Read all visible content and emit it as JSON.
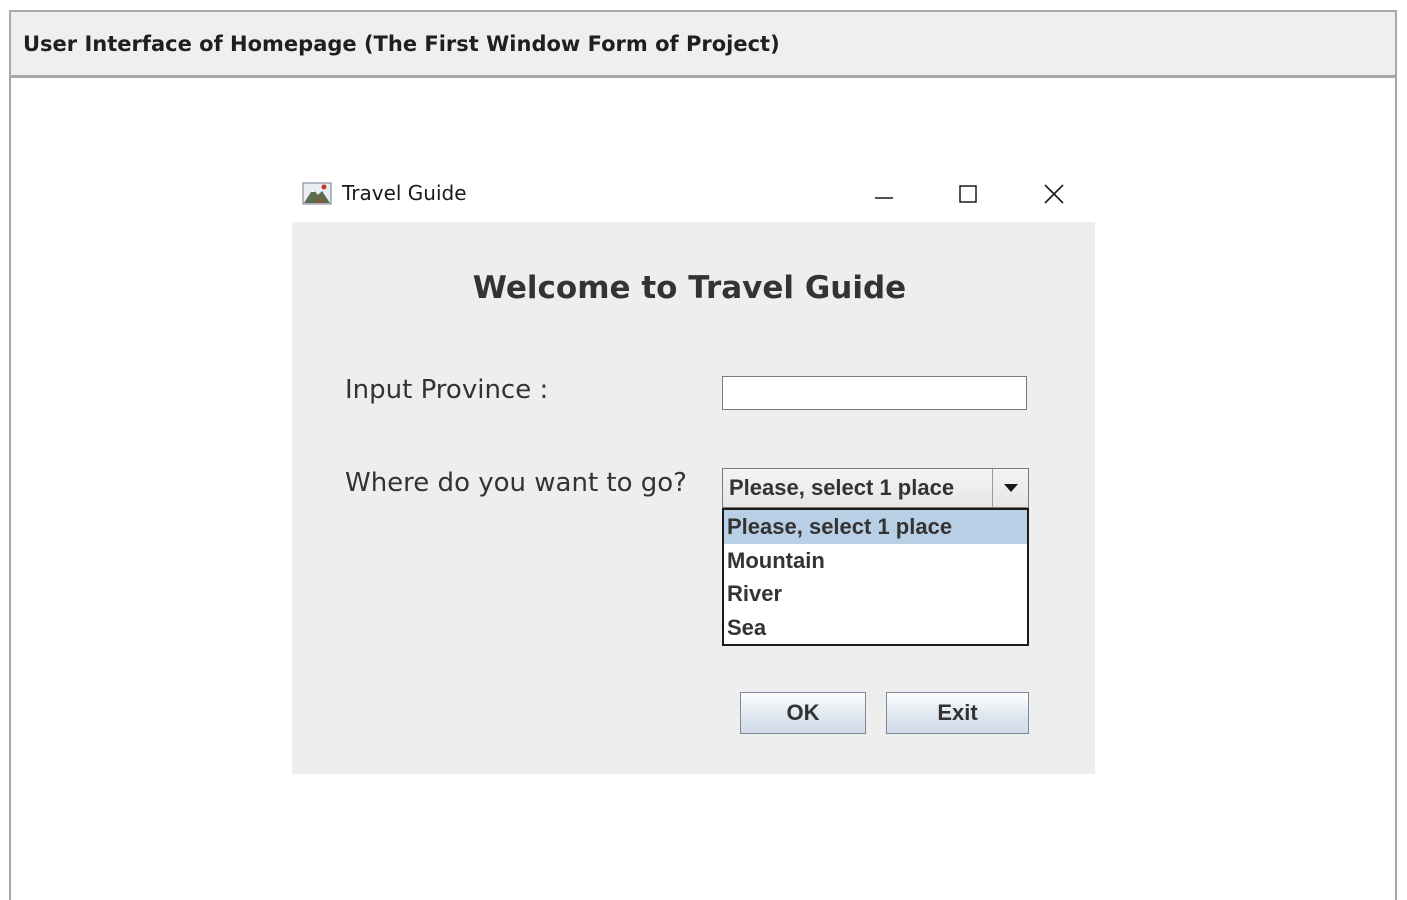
{
  "page": {
    "caption": "User Interface of Homepage (The First Window Form of Project)"
  },
  "window": {
    "title": "Travel Guide",
    "icon": "mountain-landscape-icon",
    "controls": {
      "minimize_icon": "minimize-icon",
      "maximize_icon": "maximize-icon",
      "close_icon": "close-icon"
    }
  },
  "form": {
    "welcome": "Welcome to Travel Guide",
    "province_label": "Input Province :",
    "province_value": "",
    "where_label": "Where do you want to go?",
    "combo_selected": "Please, select 1 place",
    "combo_options": [
      "Please, select 1 place",
      "Mountain",
      "River",
      "Sea"
    ],
    "ok_label": "OK",
    "exit_label": "Exit"
  },
  "colors": {
    "header_bg": "#efefef",
    "client_bg": "#eeeeee",
    "selected_item": "#b8cfe5",
    "text": "#333333"
  }
}
